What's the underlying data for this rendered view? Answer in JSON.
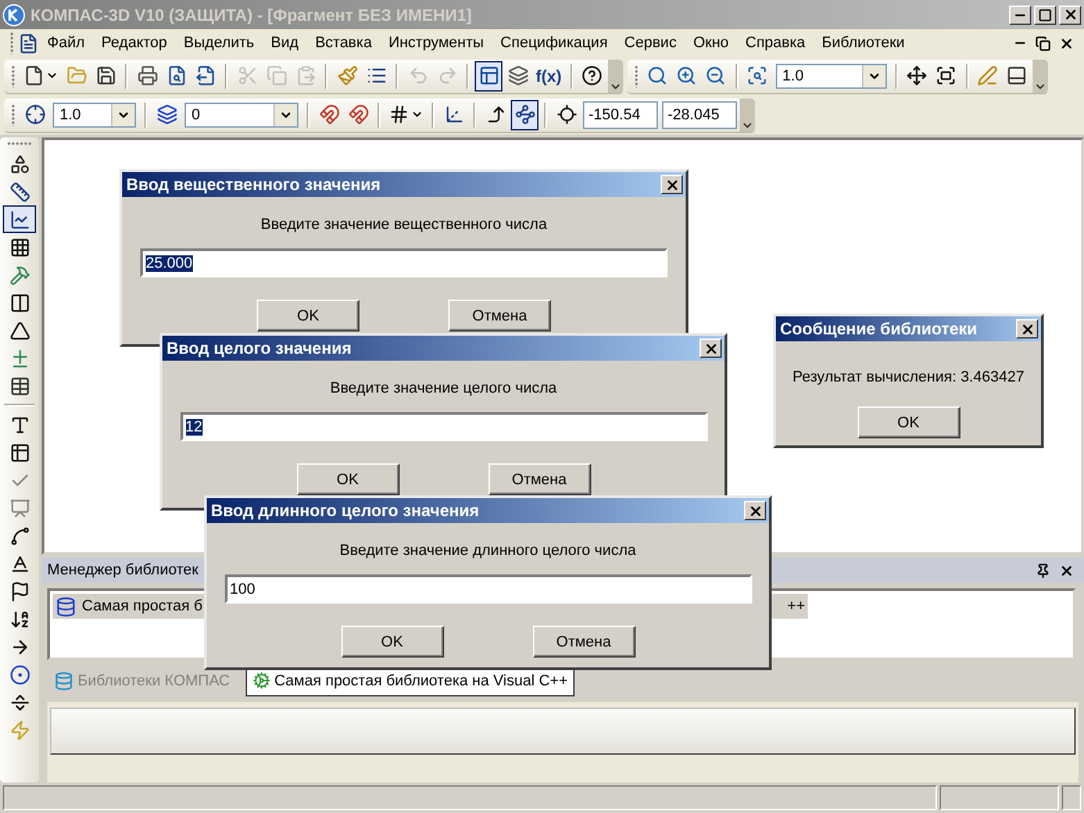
{
  "window": {
    "title": "КОМПАС-3D V10 (ЗАЩИТА) - [Фрагмент БЕЗ ИМЕНИ1]"
  },
  "menu": [
    "Файл",
    "Редактор",
    "Выделить",
    "Вид",
    "Вставка",
    "Инструменты",
    "Спецификация",
    "Сервис",
    "Окно",
    "Справка",
    "Библиотеки"
  ],
  "toolbar_rows": [
    {
      "toolbars": [
        {
          "items": [
            {
              "kind": "split-button",
              "pressed": false,
              "disabled": false
            },
            {
              "kind": "button",
              "pressed": false,
              "disabled": false
            },
            {
              "kind": "button",
              "pressed": false,
              "disabled": false
            },
            {
              "kind": "separator"
            },
            {
              "kind": "button",
              "pressed": false,
              "disabled": false
            },
            {
              "kind": "button",
              "pressed": false,
              "disabled": false
            },
            {
              "kind": "button",
              "pressed": false,
              "disabled": false
            },
            {
              "kind": "separator"
            },
            {
              "kind": "button",
              "pressed": false,
              "disabled": true
            },
            {
              "kind": "button",
              "pressed": false,
              "disabled": true
            },
            {
              "kind": "button",
              "pressed": false,
              "disabled": true
            },
            {
              "kind": "separator"
            },
            {
              "kind": "button",
              "pressed": false,
              "disabled": false
            },
            {
              "kind": "button",
              "pressed": false,
              "disabled": false
            },
            {
              "kind": "separator"
            },
            {
              "kind": "button",
              "pressed": false,
              "disabled": true
            },
            {
              "kind": "button",
              "pressed": false,
              "disabled": true
            },
            {
              "kind": "separator"
            },
            {
              "kind": "button",
              "pressed": true,
              "disabled": false
            },
            {
              "kind": "button",
              "pressed": false,
              "disabled": false
            },
            {
              "kind": "text-button",
              "label": "f(x)",
              "pressed": false,
              "disabled": false
            },
            {
              "kind": "separator"
            },
            {
              "kind": "button",
              "pressed": false,
              "disabled": false
            }
          ]
        },
        {
          "items": [
            {
              "kind": "button",
              "pressed": false,
              "disabled": false
            },
            {
              "kind": "button",
              "pressed": false,
              "disabled": false
            },
            {
              "kind": "button",
              "pressed": false,
              "disabled": false
            },
            {
              "kind": "separator"
            },
            {
              "kind": "button",
              "pressed": false,
              "disabled": false
            },
            {
              "kind": "combo",
              "value": "1.0"
            },
            {
              "kind": "separator"
            },
            {
              "kind": "button",
              "pressed": false,
              "disabled": false
            },
            {
              "kind": "button",
              "pressed": false,
              "disabled": false
            },
            {
              "kind": "separator"
            },
            {
              "kind": "button",
              "pressed": false,
              "disabled": false
            },
            {
              "kind": "button",
              "pressed": false,
              "disabled": false
            }
          ]
        }
      ]
    },
    {
      "toolbars": [
        {
          "items": [
            {
              "kind": "button",
              "pressed": false,
              "disabled": false
            },
            {
              "kind": "combo",
              "value": "1.0"
            },
            {
              "kind": "separator"
            },
            {
              "kind": "button",
              "pressed": false,
              "disabled": false
            },
            {
              "kind": "combo",
              "value": "0"
            },
            {
              "kind": "separator"
            },
            {
              "kind": "button",
              "pressed": false,
              "disabled": false
            },
            {
              "kind": "button",
              "pressed": false,
              "disabled": false
            },
            {
              "kind": "separator"
            },
            {
              "kind": "split-button",
              "pressed": false,
              "disabled": false
            },
            {
              "kind": "separator"
            },
            {
              "kind": "button",
              "pressed": false,
              "disabled": false
            },
            {
              "kind": "separator"
            },
            {
              "kind": "button",
              "pressed": false,
              "disabled": false
            },
            {
              "kind": "button",
              "pressed": true,
              "disabled": false
            },
            {
              "kind": "separator"
            },
            {
              "kind": "button",
              "pressed": false,
              "disabled": false
            },
            {
              "kind": "field",
              "value": "-150.54"
            },
            {
              "kind": "field",
              "value": "-28.045"
            }
          ]
        }
      ]
    }
  ],
  "left_toolbar": [
    {
      "kind": "button",
      "pressed": false,
      "disabled": false
    },
    {
      "kind": "button",
      "pressed": false,
      "disabled": false
    },
    {
      "kind": "button",
      "pressed": true,
      "disabled": false
    },
    {
      "kind": "button",
      "pressed": false,
      "disabled": false
    },
    {
      "kind": "button",
      "pressed": false,
      "disabled": false
    },
    {
      "kind": "button",
      "pressed": false,
      "disabled": false
    },
    {
      "kind": "button",
      "pressed": false,
      "disabled": false
    },
    {
      "kind": "button",
      "pressed": false,
      "disabled": false
    },
    {
      "kind": "button",
      "pressed": false,
      "disabled": false
    },
    {
      "kind": "separator"
    },
    {
      "kind": "button",
      "pressed": false,
      "disabled": false
    },
    {
      "kind": "button",
      "pressed": false,
      "disabled": false
    },
    {
      "kind": "button",
      "pressed": false,
      "disabled": true
    },
    {
      "kind": "button",
      "pressed": false,
      "disabled": true
    },
    {
      "kind": "button",
      "pressed": false,
      "disabled": false
    },
    {
      "kind": "button",
      "pressed": false,
      "disabled": false
    },
    {
      "kind": "button",
      "pressed": false,
      "disabled": false
    },
    {
      "kind": "button",
      "pressed": false,
      "disabled": false
    },
    {
      "kind": "button",
      "pressed": false,
      "disabled": false
    },
    {
      "kind": "button",
      "pressed": false,
      "disabled": false
    },
    {
      "kind": "button",
      "pressed": false,
      "disabled": false
    },
    {
      "kind": "button",
      "pressed": false,
      "disabled": false
    }
  ],
  "library_manager": {
    "title": "Менеджер библиотек",
    "item": {
      "text_start": "Самая простая б",
      "text_end": "++",
      "selected": true
    },
    "tabs": [
      {
        "label": "Библиотеки КОМПАС",
        "selected": false
      },
      {
        "label": "Самая простая библиотека на Visual C++",
        "selected": true
      }
    ]
  },
  "dialogs": [
    {
      "kind": "input",
      "title": "Ввод вещественного значения",
      "prompt": "Введите значение вещественного числа",
      "value": "25.000",
      "selected": true,
      "buttons": [
        "OK",
        "Отмена"
      ]
    },
    {
      "kind": "input",
      "title": "Ввод целого значения",
      "prompt": "Введите значение целого числа",
      "value": "12",
      "selected": true,
      "buttons": [
        "OK",
        "Отмена"
      ]
    },
    {
      "kind": "input",
      "title": "Ввод длинного целого значения",
      "prompt": "Введите значение длинного целого числа",
      "value": "100",
      "selected": false,
      "buttons": [
        "OK",
        "Отмена"
      ]
    },
    {
      "kind": "message",
      "title": "Сообщение библиотеки",
      "prompt": "Результат вычисления: 3.463427",
      "buttons": [
        "OK"
      ]
    }
  ]
}
